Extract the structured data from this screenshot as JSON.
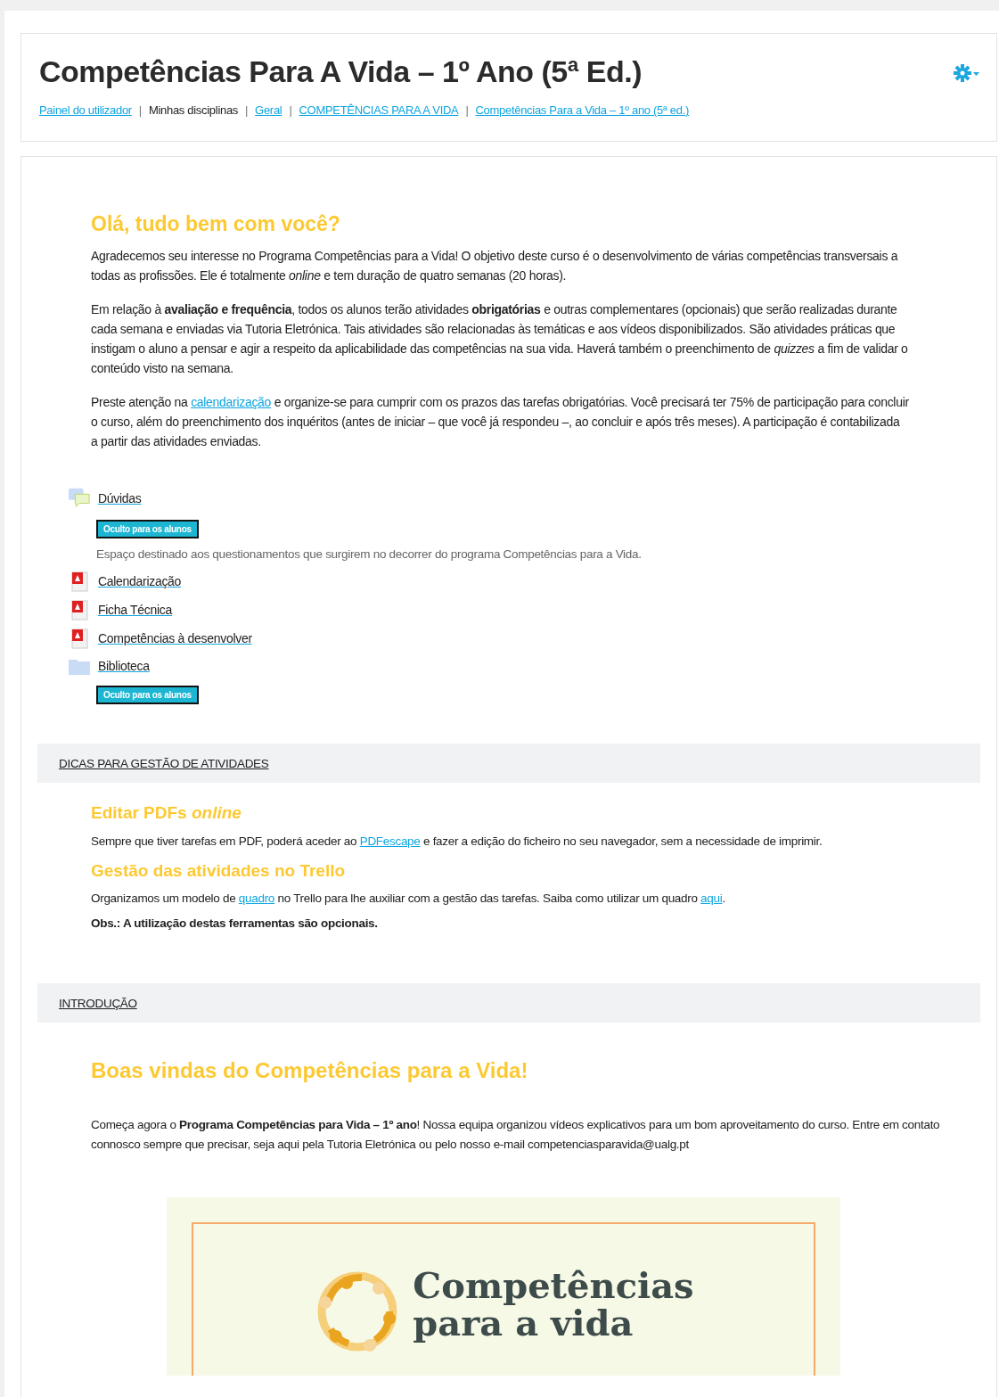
{
  "header": {
    "title": "Competências Para A Vida – 1º Ano (5ª Ed.)",
    "separator": "|",
    "breadcrumb": [
      {
        "kind": "link",
        "label": "Painel do utilizador"
      },
      {
        "kind": "text",
        "label": "Minhas disciplinas"
      },
      {
        "kind": "link",
        "label": "Geral"
      },
      {
        "kind": "link",
        "label": "COMPETÊNCIAS PARA A VIDA"
      },
      {
        "kind": "link",
        "label": "Competências Para a Vida – 1º ano (5ª ed.)"
      }
    ]
  },
  "intro": {
    "heading": "Olá, tudo bem com você?",
    "paragraphs": [
      [
        {
          "kind": "text",
          "text": "Agradecemos seu interesse no Programa Competências para a Vida! O objetivo deste curso é o desenvolvimento de várias competências transversais a todas as profissões. Ele é totalmente *online* e tem duração de quatro semanas (20 horas)."
        }
      ],
      [
        {
          "kind": "text",
          "text": "Em relação à **avaliação e frequência**, todos os alunos terão atividades **obrigatórias** e outras complementares (opcionais) que serão realizadas durante cada semana e enviadas via Tutoria Eletrónica. Tais atividades são relacionadas às temáticas e aos vídeos disponibilizados. São atividades práticas que instigam o aluno a pensar e agir a respeito da aplicabilidade das competências na sua vida. Haverá também o preenchimento de *quizzes* a fim de validar o conteúdo visto na semana."
        }
      ],
      [
        {
          "kind": "text",
          "text": "Preste atenção na "
        },
        {
          "kind": "link",
          "text": "calendarização"
        },
        {
          "kind": "text",
          "text": " e organize-se para cumprir com os prazos das tarefas obrigatórias. Você precisará ter 75% de participação para concluir o curso, além do preenchimento dos inquéritos (antes de iniciar – que você já respondeu –, ao concluir e após três meses). A participação é contabilizada a partir das atividades enviadas."
        }
      ]
    ]
  },
  "activities": [
    {
      "kind": "forum",
      "name": "Dúvidas",
      "hidden_badge": "Oculto para os alunos",
      "description": "Espaço destinado aos questionamentos que surgirem no decorrer do programa Competências para a Vida."
    },
    {
      "kind": "pdf",
      "name": "Calendarização"
    },
    {
      "kind": "pdf",
      "name": "Ficha Técnica"
    },
    {
      "kind": "pdf",
      "name": "Competências à desenvolver"
    },
    {
      "kind": "folder",
      "name": "Biblioteca",
      "hidden_badge": "Oculto para os alunos"
    }
  ],
  "sections": [
    {
      "title": "DICAS PARA GESTÃO DE ATIVIDADES",
      "blocks": [
        {
          "kind": "heading",
          "text": "Editar PDFs *online*"
        },
        {
          "kind": "paragraph",
          "segments": [
            {
              "kind": "text",
              "text": "Sempre que tiver tarefas em PDF, poderá aceder ao "
            },
            {
              "kind": "link",
              "text": "PDFescape"
            },
            {
              "kind": "text",
              "text": " e fazer a edição do ficheiro no seu navegador, sem a necessidade de imprimir."
            }
          ]
        },
        {
          "kind": "heading",
          "text": "Gestão das atividades no Trello"
        },
        {
          "kind": "paragraph",
          "segments": [
            {
              "kind": "text",
              "text": "Organizamos um modelo de "
            },
            {
              "kind": "link",
              "text": "quadro"
            },
            {
              "kind": "text",
              "text": " no Trello para lhe auxiliar com a gestão das tarefas. Saiba como utilizar um quadro "
            },
            {
              "kind": "link",
              "text": "aqui"
            },
            {
              "kind": "text",
              "text": "."
            }
          ]
        },
        {
          "kind": "paragraph",
          "segments": [
            {
              "kind": "text",
              "text": "**Obs.: A utilização destas ferramentas são opcionais.**"
            }
          ]
        }
      ]
    },
    {
      "title": "INTRODUÇÃO",
      "blocks": [
        {
          "kind": "heading_large",
          "text": "Boas vindas do Competências para a Vida!"
        },
        {
          "kind": "paragraph",
          "segments": [
            {
              "kind": "text",
              "text": "Começa agora o **Programa Competências para Vida – 1º ano**! Nossa equipa organizou vídeos explicativos para um bom aproveitamento do curso. Entre em contato connosco sempre que precisar, seja aqui pela Tutoria Eletrónica ou pelo nosso e-mail competenciasparavida@ualg.pt"
            }
          ]
        },
        {
          "kind": "banner",
          "line1": "Competências",
          "line2": "para a vida"
        }
      ]
    }
  ]
}
